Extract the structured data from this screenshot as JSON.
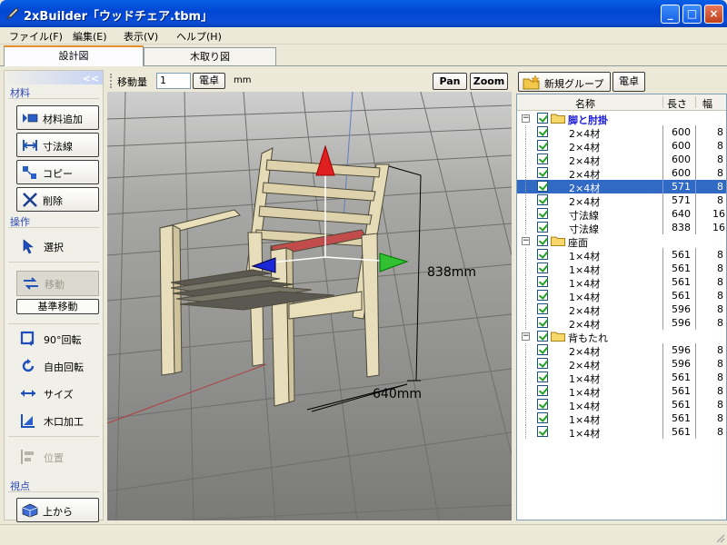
{
  "window": {
    "title": "2xBuilder「ウッドチェア.tbm」",
    "min": "_",
    "max": "□",
    "close": "×"
  },
  "menu": [
    "ファイル(F)",
    "編集(E)",
    "表示(V)",
    "ヘルプ(H)"
  ],
  "tabs": [
    "設計図",
    "木取り図"
  ],
  "left": {
    "collapse": "<<",
    "sec_material": "材料",
    "btn_add": "材料追加",
    "btn_dim": "寸法線",
    "btn_copy": "コピー",
    "btn_delete": "削除",
    "sec_ops": "操作",
    "tool_select": "選択",
    "tool_move": "移動",
    "tool_basemove": "基準移動",
    "tool_rot90": "90°回転",
    "tool_freerot": "自由回転",
    "tool_size": "サイズ",
    "tool_kiguchi": "木口加工",
    "tool_pos": "位置",
    "sec_view": "視点",
    "view_top": "上から"
  },
  "toolbar": {
    "move_label": "移動量",
    "move_value": "1",
    "calc": "電卓",
    "unit": "mm",
    "pan": "Pan",
    "zoom": "Zoom"
  },
  "viewport": {
    "dim_height": "838mm",
    "dim_width": "640mm"
  },
  "right": {
    "new_group": "新規グループ",
    "calc": "電卓"
  },
  "tree": {
    "headers": {
      "name": "名称",
      "length": "長さ",
      "width": "幅"
    },
    "rows": [
      {
        "type": "group",
        "name": "脚と肘掛",
        "len": "",
        "w": ""
      },
      {
        "type": "item",
        "name": "2×4材",
        "len": "600",
        "w": "8"
      },
      {
        "type": "item",
        "name": "2×4材",
        "len": "600",
        "w": "8"
      },
      {
        "type": "item",
        "name": "2×4材",
        "len": "600",
        "w": "8"
      },
      {
        "type": "item",
        "name": "2×4材",
        "len": "600",
        "w": "8"
      },
      {
        "type": "item",
        "name": "2×4材",
        "len": "571",
        "w": "8",
        "selected": true
      },
      {
        "type": "item",
        "name": "2×4材",
        "len": "571",
        "w": "8"
      },
      {
        "type": "item",
        "name": "寸法線",
        "len": "640",
        "w": "16"
      },
      {
        "type": "item",
        "name": "寸法線",
        "len": "838",
        "w": "16"
      },
      {
        "type": "group",
        "name": "座面",
        "len": "",
        "w": ""
      },
      {
        "type": "item",
        "name": "1×4材",
        "len": "561",
        "w": "8"
      },
      {
        "type": "item",
        "name": "1×4材",
        "len": "561",
        "w": "8"
      },
      {
        "type": "item",
        "name": "1×4材",
        "len": "561",
        "w": "8"
      },
      {
        "type": "item",
        "name": "1×4材",
        "len": "561",
        "w": "8"
      },
      {
        "type": "item",
        "name": "2×4材",
        "len": "596",
        "w": "8"
      },
      {
        "type": "item",
        "name": "2×4材",
        "len": "596",
        "w": "8"
      },
      {
        "type": "group",
        "name": "背もたれ",
        "len": "",
        "w": ""
      },
      {
        "type": "item",
        "name": "2×4材",
        "len": "596",
        "w": "8"
      },
      {
        "type": "item",
        "name": "2×4材",
        "len": "596",
        "w": "8"
      },
      {
        "type": "item",
        "name": "1×4材",
        "len": "561",
        "w": "8"
      },
      {
        "type": "item",
        "name": "1×4材",
        "len": "561",
        "w": "8"
      },
      {
        "type": "item",
        "name": "1×4材",
        "len": "561",
        "w": "8"
      },
      {
        "type": "item",
        "name": "1×4材",
        "len": "561",
        "w": "8"
      },
      {
        "type": "item",
        "name": "1×4材",
        "len": "561",
        "w": "8"
      }
    ]
  },
  "colors": {
    "titlebar": "#0a5fe6",
    "selection": "#316ac5",
    "section_text": "#2a48b8",
    "group_text": "#1a1adb",
    "wood": "#e8dcb4"
  }
}
